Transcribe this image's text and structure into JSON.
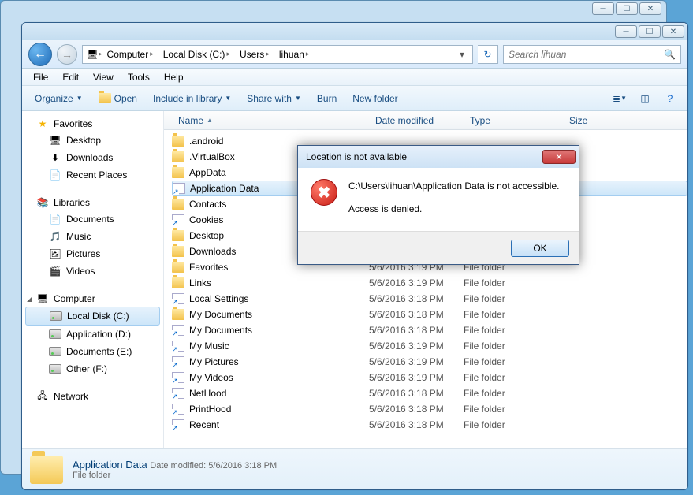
{
  "breadcrumb": [
    "Computer",
    "Local Disk (C:)",
    "Users",
    "lihuan"
  ],
  "search_placeholder": "Search lihuan",
  "menubar": [
    "File",
    "Edit",
    "View",
    "Tools",
    "Help"
  ],
  "toolbar": {
    "organize": "Organize",
    "open": "Open",
    "include": "Include in library",
    "share": "Share with",
    "burn": "Burn",
    "newfolder": "New folder"
  },
  "sidebar": {
    "favorites": {
      "label": "Favorites",
      "items": [
        "Desktop",
        "Downloads",
        "Recent Places"
      ]
    },
    "libraries": {
      "label": "Libraries",
      "items": [
        "Documents",
        "Music",
        "Pictures",
        "Videos"
      ]
    },
    "computer": {
      "label": "Computer",
      "items": [
        "Local Disk (C:)",
        "Application (D:)",
        "Documents (E:)",
        "Other (F:)"
      ],
      "selected": 0
    },
    "network": {
      "label": "Network"
    }
  },
  "columns": {
    "name": "Name",
    "date": "Date modified",
    "type": "Type",
    "size": "Size"
  },
  "selected_row": 2,
  "files": [
    {
      "name": ".android",
      "date": "",
      "type": "",
      "icon": "folder"
    },
    {
      "name": ".VirtualBox",
      "date": "",
      "type": "",
      "icon": "folder"
    },
    {
      "name": "AppData",
      "date": "",
      "type": "",
      "icon": "folder"
    },
    {
      "name": "Application Data",
      "date": "",
      "type": "",
      "icon": "shortcut"
    },
    {
      "name": "Contacts",
      "date": "",
      "type": "",
      "icon": "folder"
    },
    {
      "name": "Cookies",
      "date": "",
      "type": "",
      "icon": "shortcut"
    },
    {
      "name": "Desktop",
      "date": "",
      "type": "",
      "icon": "folder"
    },
    {
      "name": "Downloads",
      "date": "",
      "type": "",
      "icon": "folder"
    },
    {
      "name": "Favorites",
      "date": "5/6/2016 3:19 PM",
      "type": "File folder",
      "icon": "folder"
    },
    {
      "name": "Links",
      "date": "5/6/2016 3:19 PM",
      "type": "File folder",
      "icon": "folder"
    },
    {
      "name": "Local Settings",
      "date": "5/6/2016 3:18 PM",
      "type": "File folder",
      "icon": "shortcut"
    },
    {
      "name": "My Documents",
      "date": "5/6/2016 3:18 PM",
      "type": "File folder",
      "icon": "folder"
    },
    {
      "name": "My Documents",
      "date": "5/6/2016 3:18 PM",
      "type": "File folder",
      "icon": "shortcut"
    },
    {
      "name": "My Music",
      "date": "5/6/2016 3:19 PM",
      "type": "File folder",
      "icon": "shortcut"
    },
    {
      "name": "My Pictures",
      "date": "5/6/2016 3:19 PM",
      "type": "File folder",
      "icon": "shortcut"
    },
    {
      "name": "My Videos",
      "date": "5/6/2016 3:19 PM",
      "type": "File folder",
      "icon": "shortcut"
    },
    {
      "name": "NetHood",
      "date": "5/6/2016 3:18 PM",
      "type": "File folder",
      "icon": "shortcut"
    },
    {
      "name": "PrintHood",
      "date": "5/6/2016 3:18 PM",
      "type": "File folder",
      "icon": "shortcut"
    },
    {
      "name": "Recent",
      "date": "5/6/2016 3:18 PM",
      "type": "File folder",
      "icon": "shortcut"
    }
  ],
  "details": {
    "name": "Application Data",
    "meta_label": "Date modified:",
    "meta_value": "5/6/2016 3:18 PM",
    "type": "File folder"
  },
  "dialog": {
    "title": "Location is not available",
    "line1": "C:\\Users\\lihuan\\Application Data is not accessible.",
    "line2": "Access is denied.",
    "ok": "OK"
  }
}
